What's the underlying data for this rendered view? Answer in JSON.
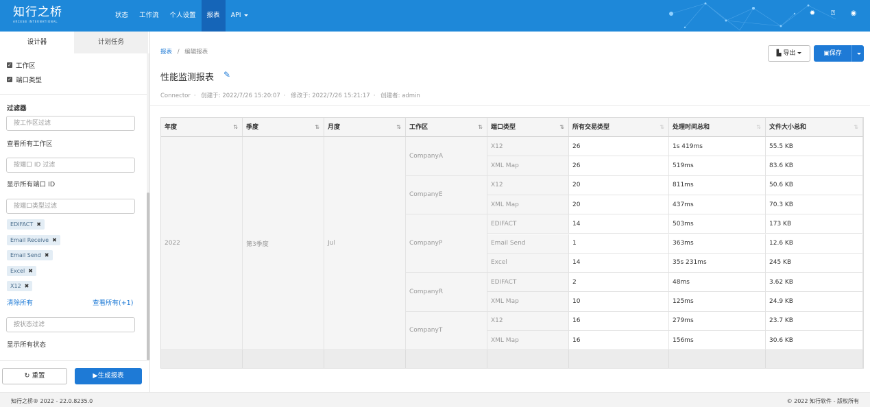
{
  "topnav": {
    "logo_cn": "知行之桥",
    "logo_en": "ARCESB INTERNATIONAL",
    "items": [
      "状态",
      "工作流",
      "个人设置",
      "报表",
      "API"
    ],
    "active_index": 3,
    "icons": [
      "gear-icon",
      "help-icon",
      "user-icon"
    ]
  },
  "sidebar": {
    "tabs": [
      "设计器",
      "计划任务"
    ],
    "checks": [
      "工作区",
      "端口类型"
    ],
    "filter_title": "过滤器",
    "ws_placeholder": "按工作区过滤",
    "ws_hint": "查看所有工作区",
    "port_placeholder": "按端口 ID 过滤",
    "port_hint": "显示所有端口 ID",
    "type_placeholder": "按端口类型过滤",
    "chips": [
      "EDIFACT",
      "Email Receive",
      "Email Send",
      "Excel",
      "X12"
    ],
    "clear_all": "清除所有",
    "view_all": "查看所有(+1)",
    "status_placeholder": "按状态过滤",
    "status_hint": "显示所有状态",
    "reset": "重置",
    "generate": "生成报表"
  },
  "main": {
    "breadcrumb_root": "报表",
    "breadcrumb_sep": "/",
    "breadcrumb_current": "编辑报表",
    "export": "导出",
    "save": "保存",
    "title": "性能监测报表",
    "meta": {
      "connector": "Connector",
      "created": "创建于: 2022/7/26 15:20:07",
      "modified": "修改于: 2022/7/26 15:21:17",
      "creator": "创建者: admin"
    }
  },
  "table": {
    "headers": [
      "年度",
      "季度",
      "月度",
      "工作区",
      "端口类型",
      "所有交易类型",
      "处理时间总和",
      "文件大小总和"
    ],
    "year": "2022",
    "quarter": "第3季度",
    "month": "Jul",
    "groups": [
      {
        "workspace": "CompanyA",
        "rows": [
          [
            "X12",
            "26",
            "1s 419ms",
            "55.5 KB"
          ],
          [
            "XML Map",
            "26",
            "519ms",
            "83.6 KB"
          ]
        ]
      },
      {
        "workspace": "CompanyE",
        "rows": [
          [
            "X12",
            "20",
            "811ms",
            "50.6 KB"
          ],
          [
            "XML Map",
            "20",
            "437ms",
            "70.3 KB"
          ]
        ]
      },
      {
        "workspace": "CompanyP",
        "rows": [
          [
            "EDIFACT",
            "14",
            "503ms",
            "173 KB"
          ],
          [
            "Email Send",
            "1",
            "363ms",
            "12.6 KB"
          ],
          [
            "Excel",
            "14",
            "35s 231ms",
            "245 KB"
          ]
        ]
      },
      {
        "workspace": "CompanyR",
        "rows": [
          [
            "EDIFACT",
            "2",
            "48ms",
            "3.62 KB"
          ],
          [
            "XML Map",
            "10",
            "125ms",
            "24.9 KB"
          ]
        ]
      },
      {
        "workspace": "CompanyT",
        "rows": [
          [
            "X12",
            "16",
            "279ms",
            "23.7 KB"
          ],
          [
            "XML Map",
            "16",
            "156ms",
            "30.6 KB"
          ]
        ]
      }
    ]
  },
  "footer": {
    "left": "知行之桥® 2022 - 22.0.8235.0",
    "right": "© 2022 知行软件 - 版权所有"
  }
}
